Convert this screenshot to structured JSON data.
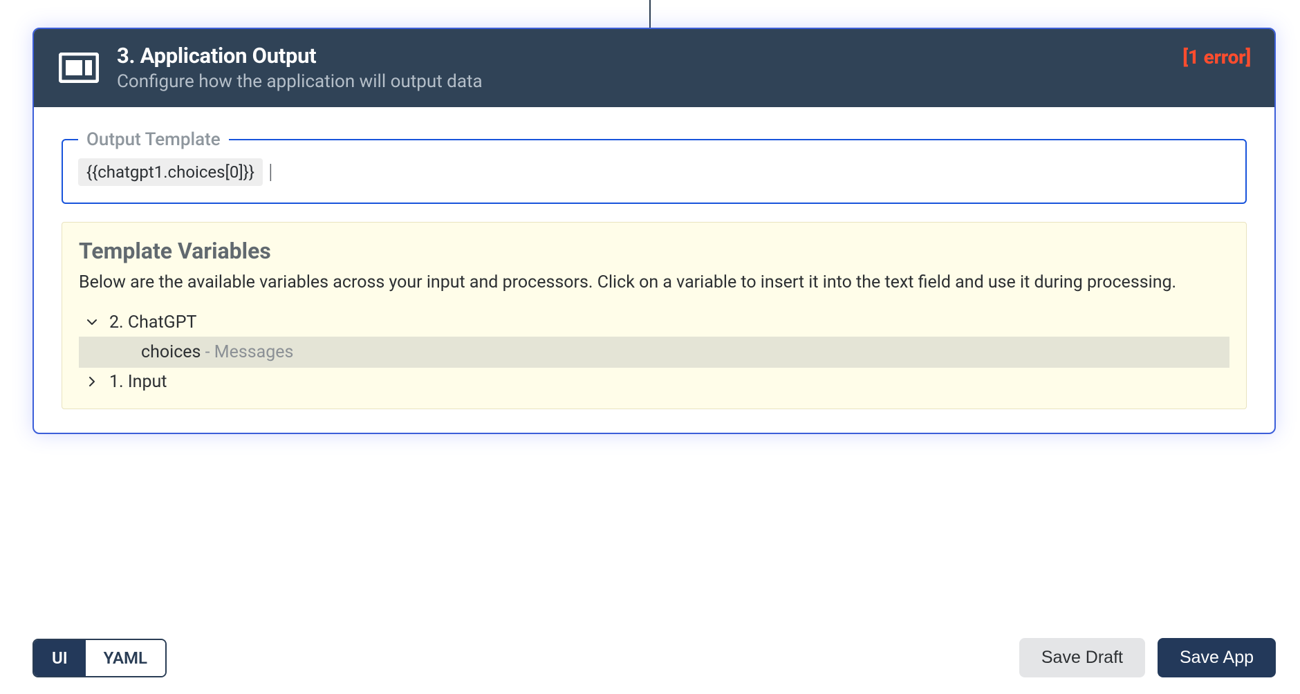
{
  "card": {
    "title": "3. Application Output",
    "subtitle": "Configure how the application will output data",
    "error_badge": "[1 error]"
  },
  "field": {
    "legend": "Output Template",
    "chip_text": "{{chatgpt1.choices[0]}}"
  },
  "template_vars": {
    "title": "Template Variables",
    "description": "Below are the available variables across your input and processors. Click on a variable to insert it into the text field and use it during processing.",
    "tree": {
      "node_chatgpt": {
        "label": "2. ChatGPT"
      },
      "child_choices": {
        "name": "choices",
        "desc": " - Messages"
      },
      "node_input": {
        "label": "1. Input"
      }
    }
  },
  "toggle": {
    "ui": "UI",
    "yaml": "YAML"
  },
  "buttons": {
    "save_draft": "Save Draft",
    "save_app": "Save App"
  }
}
